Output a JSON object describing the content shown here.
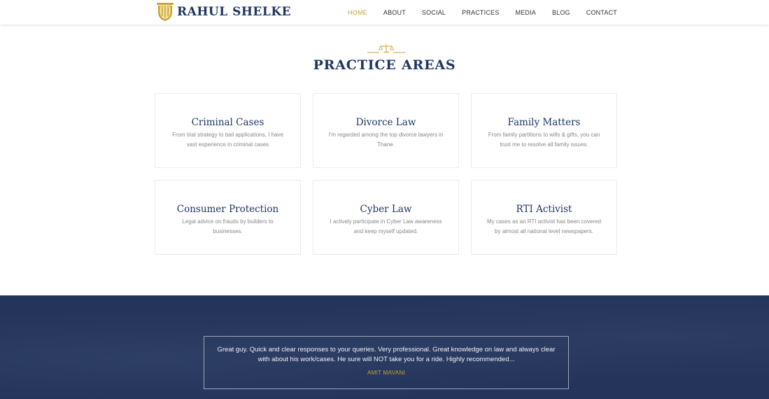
{
  "brand": {
    "name": "RAHUL SHELKE",
    "logo_icon": "pillar-icon",
    "accent": "#c9a330",
    "primary": "#1f3563"
  },
  "nav": {
    "items": [
      {
        "label": "HOME",
        "active": true
      },
      {
        "label": "ABOUT",
        "active": false
      },
      {
        "label": "SOCIAL",
        "active": false
      },
      {
        "label": "PRACTICES",
        "active": false
      },
      {
        "label": "MEDIA",
        "active": false
      },
      {
        "label": "BLOG",
        "active": false
      },
      {
        "label": "CONTACT",
        "active": false
      }
    ]
  },
  "practice": {
    "ornament_icon": "scales-of-justice-icon",
    "title": "PRACTICE AREAS",
    "cards": [
      {
        "title": "Criminal Cases",
        "desc": "From trial strategy to bail applications, I have vast experience in criminal cases"
      },
      {
        "title": "Divorce Law",
        "desc": "I'm regarded among the top divorce lawyers in Thane."
      },
      {
        "title": "Family Matters",
        "desc": "From family partitions to wills & gifts, you can trust me to resolve all family issues."
      },
      {
        "title": "Consumer Protection",
        "desc": "Legal advice on frauds by builders to businesses."
      },
      {
        "title": "Cyber Law",
        "desc": "I actively participate in Cyber Law awareness and keep myself updated."
      },
      {
        "title": "RTI Activist",
        "desc": "My cases as an RTI activist has been covered by almost all national level newspapers."
      }
    ]
  },
  "testimonial": {
    "quote": "Great guy. Quick and clear responses to your queries. Very professional. Great knowledge on law and always clear with about his work/cases. He sure will NOT take you for a ride. Highly recommended...",
    "author": "AMIT MAVANI",
    "background": "#24345a"
  }
}
